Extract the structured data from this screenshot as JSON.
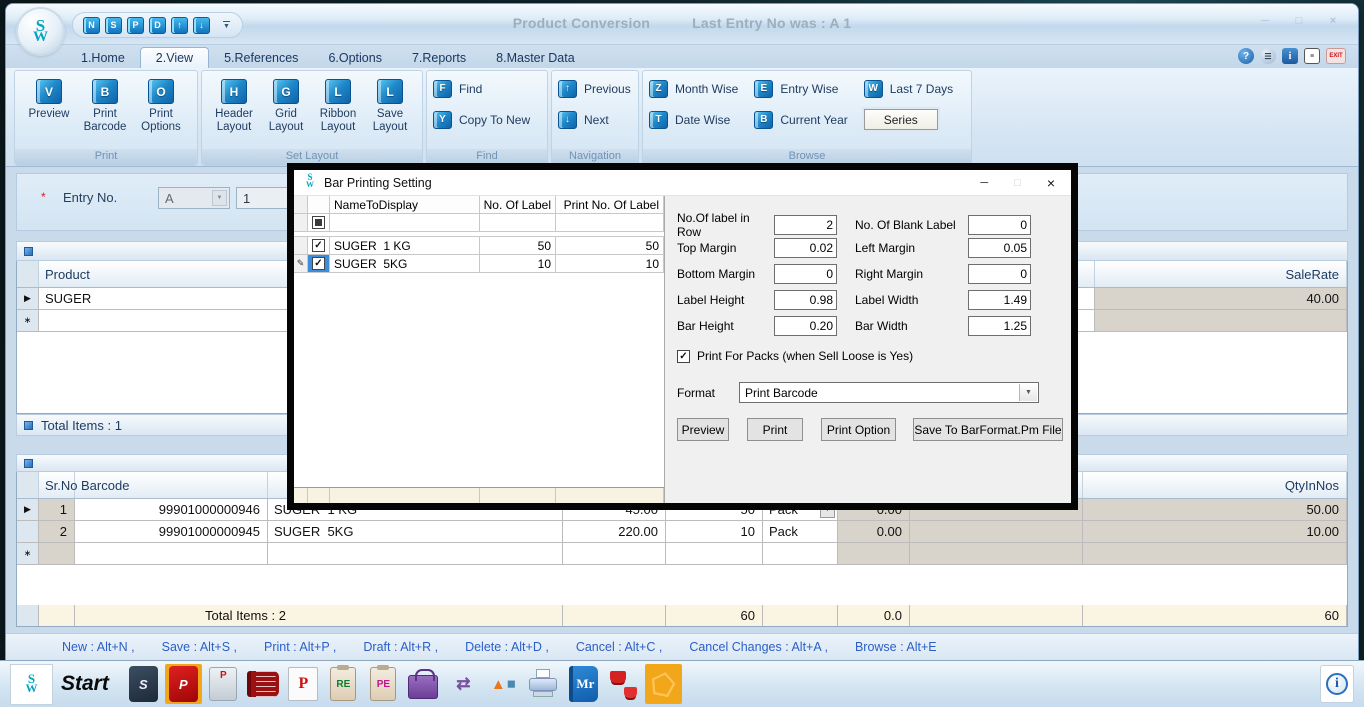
{
  "icons": {
    "row_current": "▶",
    "new_row": "∗",
    "edit_pencil": "✎",
    "check": "✓",
    "dropdown": "▼",
    "minimize": "─",
    "maximize": "□",
    "close": "×",
    "help": "?",
    "info": "i",
    "exit": "EXIT",
    "logo_s": "S",
    "logo_w": "W",
    "taskbar": {
      "sale": "S",
      "purchase": "P",
      "machine": "P",
      "printer_p": "P",
      "re": "RE",
      "pe": "PE",
      "mr": "Mr",
      "transfer": "⇄",
      "triangle": "▲",
      "square": "◼",
      "balloon": "i"
    }
  },
  "colors": {
    "accent_blue": "#1b74bc",
    "status_link": "#2b5fc7",
    "gray_cell": "#d8d4cb",
    "cream_row": "#faf5e2",
    "selected_cell": "#3e8ddd",
    "highlight_tile": "#f2a71b"
  },
  "titlebar": {
    "title": "Product Conversion",
    "last_entry": "Last Entry No was : A 1",
    "qat": [
      "N",
      "S",
      "P",
      "D",
      "↑",
      "↓"
    ]
  },
  "tabs": [
    {
      "label": "1.Home"
    },
    {
      "label": "2.View"
    },
    {
      "label": "5.References"
    },
    {
      "label": "6.Options"
    },
    {
      "label": "7.Reports"
    },
    {
      "label": "8.Master Data"
    }
  ],
  "ribbon": {
    "groups": [
      {
        "label": "Print"
      },
      {
        "label": "Set Layout"
      },
      {
        "label": "Find"
      },
      {
        "label": "Navigation"
      },
      {
        "label": "Browse"
      }
    ],
    "print_buttons": [
      {
        "icon": "V",
        "label": "Preview"
      },
      {
        "icon": "B",
        "label": "Print Barcode"
      },
      {
        "icon": "O",
        "label": "Print Options"
      }
    ],
    "layout_buttons": [
      {
        "icon": "H",
        "label": "Header Layout"
      },
      {
        "icon": "G",
        "label": "Grid Layout"
      },
      {
        "icon": "L",
        "label": "Ribbon Layout"
      },
      {
        "icon": "L",
        "label": "Save Layout"
      }
    ],
    "find_buttons": [
      {
        "icon": "F",
        "label": "Find"
      },
      {
        "icon": "Y",
        "label": "Copy To New"
      }
    ],
    "nav_buttons": [
      {
        "icon": "↑",
        "label": "Previous"
      },
      {
        "icon": "↓",
        "label": "Next"
      }
    ],
    "browse_buttons": [
      {
        "icon": "Z",
        "label": "Month Wise"
      },
      {
        "icon": "T",
        "label": "Date Wise"
      },
      {
        "icon": "E",
        "label": "Entry Wise"
      },
      {
        "icon": "B",
        "label": "Current Year"
      },
      {
        "icon": "W",
        "label": "Last 7 Days"
      }
    ],
    "series_label": "Series"
  },
  "form": {
    "required": "*",
    "entry_no_label": "Entry No.",
    "series": "A",
    "number": "1"
  },
  "product_grid": {
    "col_product": "Product",
    "col_salerate": "SaleRate",
    "rows": [
      {
        "product": "SUGER",
        "salerate": "40.00"
      }
    ],
    "total": "Total Items : 1"
  },
  "items_grid": {
    "col_srno": "Sr.No",
    "col_barcode": "Barcode",
    "col_qtyinnos": "QtyInNos",
    "rows": [
      {
        "srno": "1",
        "barcode": "99901000000946",
        "name": "SUGER  1 KG",
        "rate": "45.00",
        "qty": "50",
        "pack": "Pack",
        "value": "0.00",
        "qtyinnos": "50.00"
      },
      {
        "srno": "2",
        "barcode": "99901000000945",
        "name": "SUGER  5KG",
        "rate": "220.00",
        "qty": "10",
        "pack": "Pack",
        "value": "0.00",
        "qtyinnos": "10.00"
      }
    ],
    "total": {
      "label": "Total Items : 2",
      "qty": "60",
      "value": "0.0",
      "qtyinnos": "60"
    }
  },
  "statusbar": {
    "items": [
      "New : Alt+N ,",
      "Save : Alt+S ,",
      "Print : Alt+P ,",
      "Draft : Alt+R ,",
      "Delete : Alt+D ,",
      "Cancel : Alt+C ,",
      "Cancel Changes : Alt+A ,",
      "Browse : Alt+E"
    ]
  },
  "dialog": {
    "title": "Bar Printing Setting",
    "grid": {
      "col_name": "NameToDisplay",
      "col_labels": "No. Of Label",
      "col_print": "Print No. Of Label",
      "rows": [
        {
          "name": "SUGER  1 KG",
          "labels": "50",
          "print": "50"
        },
        {
          "name": "SUGER  5KG",
          "labels": "10",
          "print": "10"
        }
      ]
    },
    "fields": {
      "row_label": "No.Of label in Row",
      "row_value": "2",
      "blank_label": "No. Of Blank Label",
      "blank_value": "0",
      "top_label": "Top Margin",
      "top_value": "0.02",
      "left_label": "Left Margin",
      "left_value": "0.05",
      "bottom_label": "Bottom Margin",
      "bottom_value": "0",
      "right_label": "Right Margin",
      "right_value": "0",
      "lheight_label": "Label Height",
      "lheight_value": "0.98",
      "lwidth_label": "Label Width",
      "lwidth_value": "1.49",
      "bheight_label": "Bar Height",
      "bheight_value": "0.20",
      "bwidth_label": "Bar Width",
      "bwidth_value": "1.25"
    },
    "packs_label": "Print For Packs (when Sell Loose is Yes)",
    "format_label": "Format",
    "format_value": "Print Barcode",
    "buttons": [
      "Preview",
      "Print",
      "Print Option",
      "Save To BarFormat.Pm File"
    ]
  },
  "taskbar": {
    "start": "Start"
  }
}
